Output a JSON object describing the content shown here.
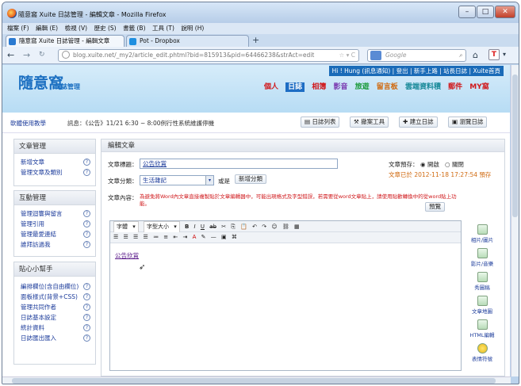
{
  "window": {
    "title": "隨意窩 Xuite 日誌管理 - 編輯文章 - Mozilla Firefox"
  },
  "menu": [
    "檔案 (F)",
    "編輯 (E)",
    "檢視 (V)",
    "歷史 (S)",
    "書籤 (B)",
    "工具 (T)",
    "說明 (H)"
  ],
  "tabs": [
    {
      "label": "隨意窩 Xuite 日誌管理 - 編輯文章"
    },
    {
      "label": "Pot - Dropbox"
    }
  ],
  "nav": {
    "url": "blog.xuite.net/_my2/article_edit.phtml?bid=815913&pid=64466238&strAct=edit",
    "search_placeholder": "Google"
  },
  "site": {
    "logo": "隨意窩",
    "logo_tag": "日誌管理",
    "toplinks": "Hi ! Hung  (訊息通知)  |  登出  |  新手上路  |  站長日誌  |  Xuite首頁",
    "nav_links": [
      "個人",
      "日誌",
      "相簿",
      "影音",
      "旅遊",
      "留言板",
      "雲端資料積",
      "郵件",
      "MY窩"
    ]
  },
  "notice": {
    "software": "軟體使用教學",
    "text": "訊息：《公告》11/21 6:30 ~ 8:00例行性系統維護停機",
    "buttons": [
      "日誌列表",
      "撤案工具",
      "建立日誌",
      "瀏覽日誌"
    ]
  },
  "sidebar": [
    {
      "title": "文章管理",
      "items": [
        "新增文章",
        "管理文章及類別"
      ]
    },
    {
      "title": "互動管理",
      "items": [
        "管理迴響與留言",
        "管理引用",
        "管理最愛連結",
        "誰拜訪過我"
      ]
    },
    {
      "title": "貼心小幫手",
      "items": [
        "編排欄位(含自由欄位)",
        "面板樣式(背景+CSS)",
        "管理共同作者",
        "日誌基本設定",
        "統計資料",
        "日誌匯出匯入"
      ]
    }
  ],
  "main": {
    "header": "編輯文章",
    "title_label": "文章標題：",
    "title_value": "公告欣賞",
    "category_label": "文章分類：",
    "category_value": "生活雜記",
    "or": "或是",
    "new_category": "新增分類",
    "preview_label": "文章預存：",
    "preview_opts": [
      "開啟",
      "關閉"
    ],
    "saved_info": "文章已於 2012-11-18 17:27:54 預存",
    "content_label": "文章內容：",
    "warning": "為避免將Word內文章直接複製貼於文章編輯器中，可能出現格式及字型錯誤，若需要從word文章貼上，請使用貼歡轉換中的從word貼上功能。",
    "preview_btn": "預覽",
    "font_label": "字體",
    "size_label": "字型大小",
    "body_text": "公告欣賞"
  },
  "tools": [
    "相片/圖片",
    "影片/音樂",
    "秀圖稿",
    "文章地圖",
    "HTML編輯",
    "表情符號"
  ]
}
